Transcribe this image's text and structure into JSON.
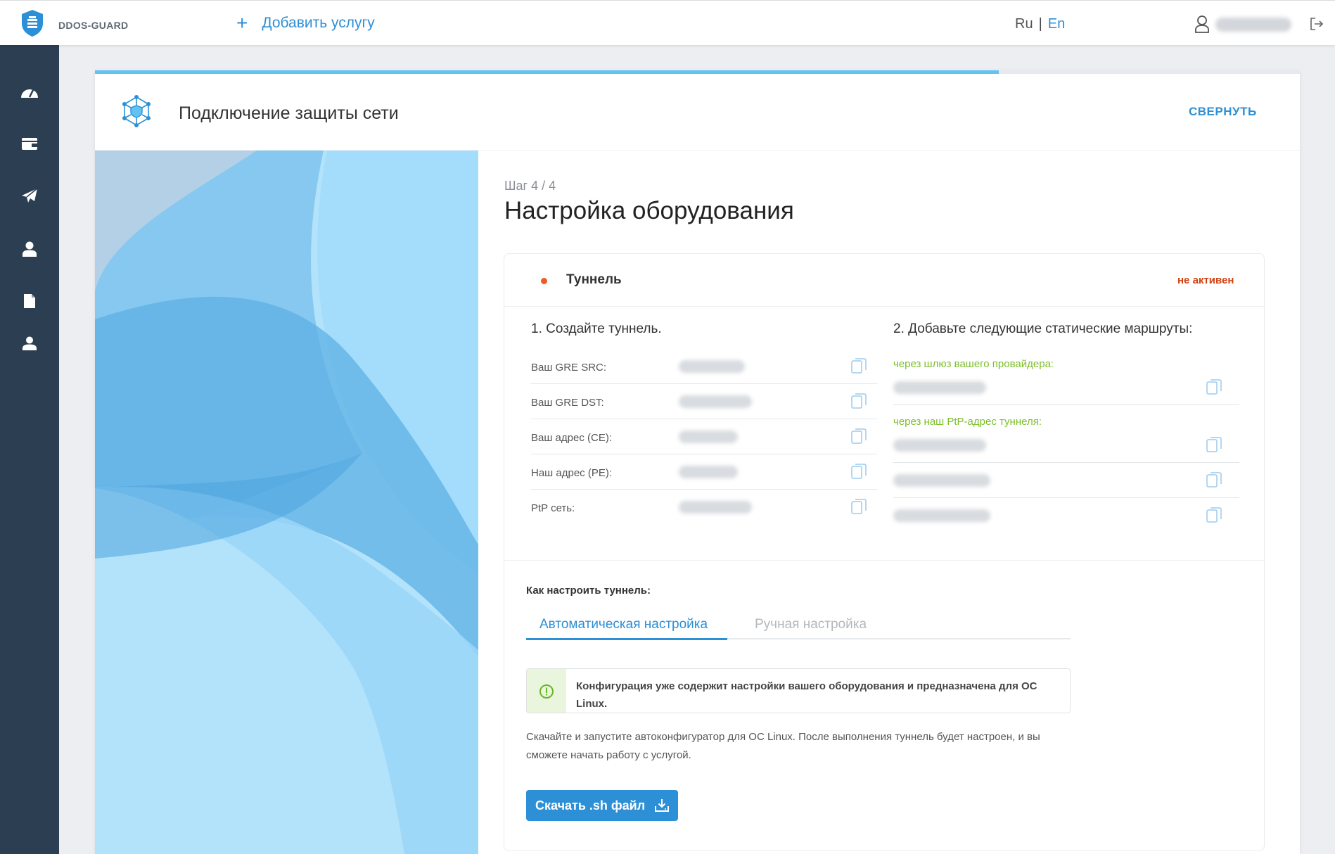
{
  "topbar": {
    "brand": "DDOS-GUARD",
    "add_service_label": "Добавить услугу",
    "lang_ru": "Ru",
    "lang_sep": "|",
    "lang_en": "En",
    "icons": [
      "shield-logo-icon",
      "plus-icon",
      "user-icon",
      "logout-icon"
    ]
  },
  "sidebar": {
    "items": [
      {
        "icon": "dashboard-icon"
      },
      {
        "icon": "wallet-icon"
      },
      {
        "icon": "paper-plane-icon"
      },
      {
        "icon": "user-icon"
      },
      {
        "icon": "document-icon"
      },
      {
        "icon": "support-user-icon"
      }
    ]
  },
  "card": {
    "title": "Подключение защиты сети",
    "collapse_label": "СВЕРНУТЬ",
    "progress": 0.75,
    "step_label": "Шаг 4 / 4",
    "step_title": "Настройка оборудования"
  },
  "tunnel": {
    "name": "Туннель",
    "status": "не активен",
    "status_color": "#d1400f",
    "section1_title": "1. Создайте туннель.",
    "params": [
      {
        "label": "Ваш GRE SRC:"
      },
      {
        "label": "Ваш GRE DST:"
      },
      {
        "label": "Ваш адрес (CE):"
      },
      {
        "label": "Наш адрес (PE):"
      },
      {
        "label": "PtP сеть:"
      }
    ],
    "section2_title": "2. Добавьте следующие статические маршруты:",
    "route_note_provider": "через шлюз вашего провайдера:",
    "route_note_ptp": "через наш PtP-адрес туннеля:"
  },
  "setup": {
    "howto_label": "Как настроить туннель:",
    "tab_auto": "Автоматическая настройка",
    "tab_manual": "Ручная настройка",
    "info_text": "Конфигурация уже содержит настройки вашего оборудования и предназначена для ОС Linux.",
    "description": "Скачайте и запустите автоконфигуратор для ОС Linux. После выполнения туннель будет настроен, и вы сможете начать работу с услугой.",
    "download_label": "Скачать .sh файл"
  },
  "colors": {
    "accent": "#2d8fd5",
    "sidebar": "#2c3e52",
    "progress": "#62c2f3",
    "route_note": "#7cbf2a",
    "status_dot": "#ee5b24"
  }
}
